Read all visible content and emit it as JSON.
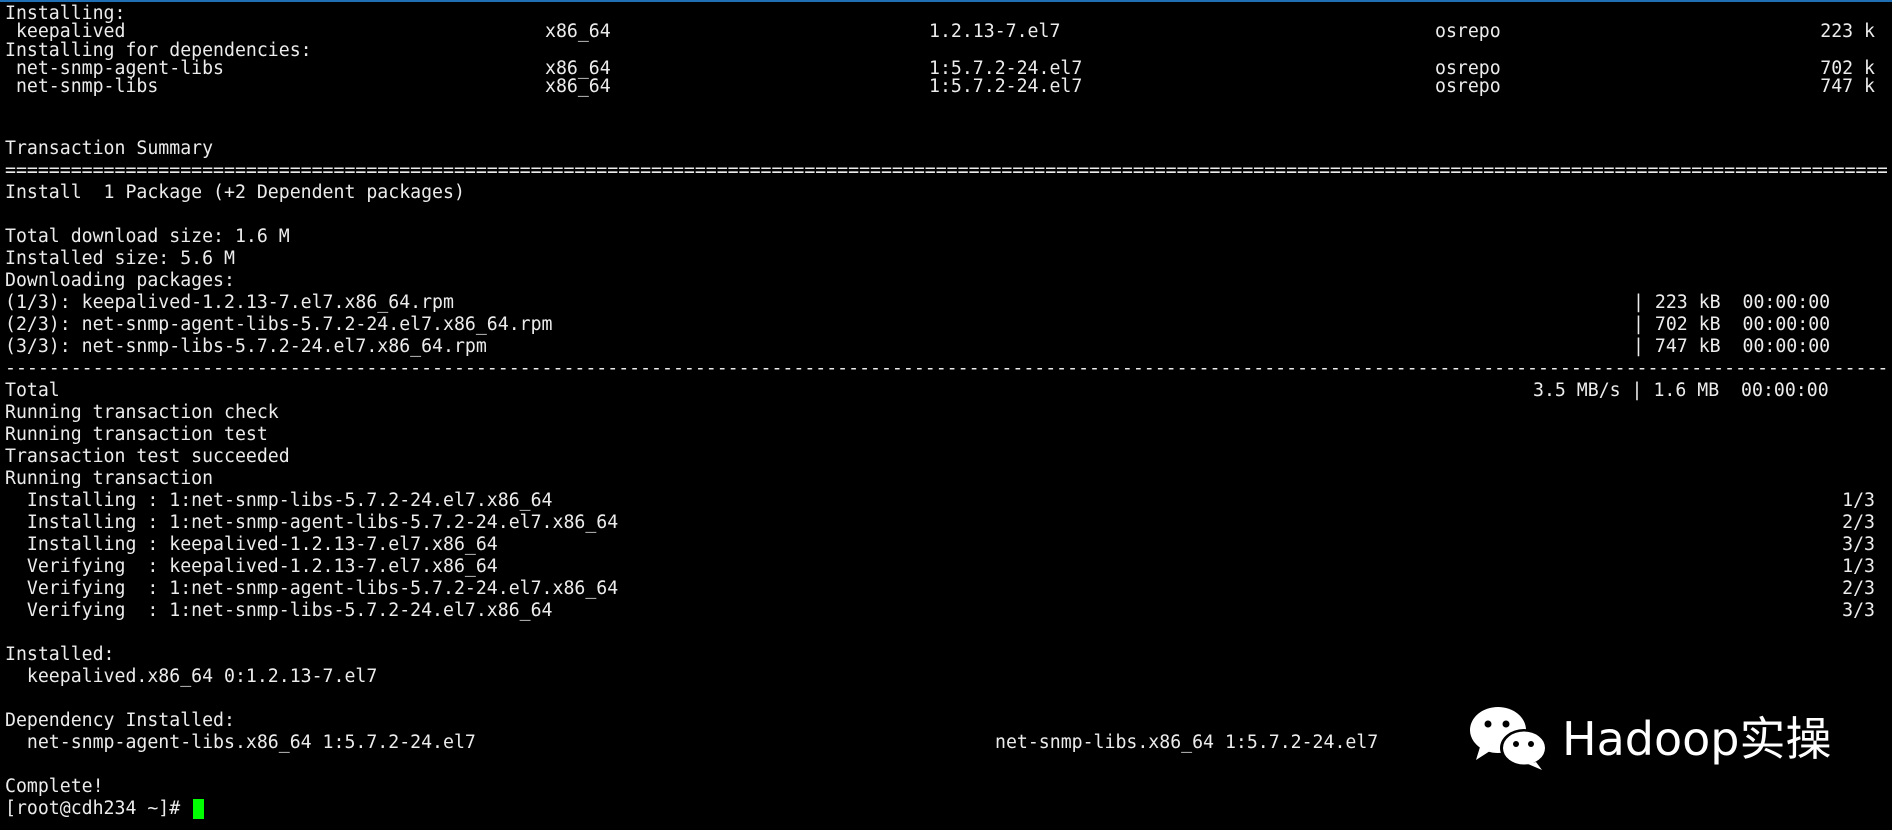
{
  "section_installing": "Installing:",
  "installing_rows": [
    {
      "name": " keepalived",
      "arch": "x86_64",
      "version": "1.2.13-7.el7",
      "repo": "osrepo",
      "size": "223 k"
    }
  ],
  "section_installing_deps": "Installing for dependencies:",
  "dep_rows": [
    {
      "name": " net-snmp-agent-libs",
      "arch": "x86_64",
      "version": "1:5.7.2-24.el7",
      "repo": "osrepo",
      "size": "702 k"
    },
    {
      "name": " net-snmp-libs",
      "arch": "x86_64",
      "version": "1:5.7.2-24.el7",
      "repo": "osrepo",
      "size": "747 k"
    }
  ],
  "transaction_summary": "Transaction Summary",
  "rule_equals": "==========================================================================================================================================================================================================",
  "install_summary": "Install  1 Package (+2 Dependent packages)",
  "total_download_size": "Total download size: 1.6 M",
  "installed_size": "Installed size: 5.6 M",
  "downloading_packages": "Downloading packages:",
  "downloads": [
    {
      "file": "(1/3): keepalived-1.2.13-7.el7.x86_64.rpm",
      "stats": "| 223 kB  00:00:00"
    },
    {
      "file": "(2/3): net-snmp-agent-libs-5.7.2-24.el7.x86_64.rpm",
      "stats": "| 702 kB  00:00:00"
    },
    {
      "file": "(3/3): net-snmp-libs-5.7.2-24.el7.x86_64.rpm",
      "stats": "| 747 kB  00:00:00"
    }
  ],
  "rule_dashes": "----------------------------------------------------------------------------------------------------------------------------------------------------------------------------------------------------------",
  "total_label": "Total",
  "total_stats": "3.5 MB/s | 1.6 MB  00:00:00",
  "tx_lines": [
    "Running transaction check",
    "Running transaction test",
    "Transaction test succeeded",
    "Running transaction"
  ],
  "progress_rows": [
    {
      "text": "  Installing : 1:net-snmp-libs-5.7.2-24.el7.x86_64",
      "count": "1/3"
    },
    {
      "text": "  Installing : 1:net-snmp-agent-libs-5.7.2-24.el7.x86_64",
      "count": "2/3"
    },
    {
      "text": "  Installing : keepalived-1.2.13-7.el7.x86_64",
      "count": "3/3"
    },
    {
      "text": "  Verifying  : keepalived-1.2.13-7.el7.x86_64",
      "count": "1/3"
    },
    {
      "text": "  Verifying  : 1:net-snmp-agent-libs-5.7.2-24.el7.x86_64",
      "count": "2/3"
    },
    {
      "text": "  Verifying  : 1:net-snmp-libs-5.7.2-24.el7.x86_64",
      "count": "3/3"
    }
  ],
  "installed_label": "Installed:",
  "installed_pkg": "  keepalived.x86_64 0:1.2.13-7.el7",
  "dependency_installed_label": "Dependency Installed:",
  "dependency_pkg_1": "  net-snmp-agent-libs.x86_64 1:5.7.2-24.el7",
  "dependency_pkg_2": "net-snmp-libs.x86_64 1:5.7.2-24.el7",
  "complete": "Complete!",
  "prompt": "[root@cdh234 ~]# ",
  "watermark": {
    "icon": "wechat-icon",
    "text": "Hadoop实操"
  },
  "colors": {
    "background": "#000000",
    "text": "#ececec",
    "cursor": "#00ff00",
    "top_border": "#1f6fb4"
  }
}
